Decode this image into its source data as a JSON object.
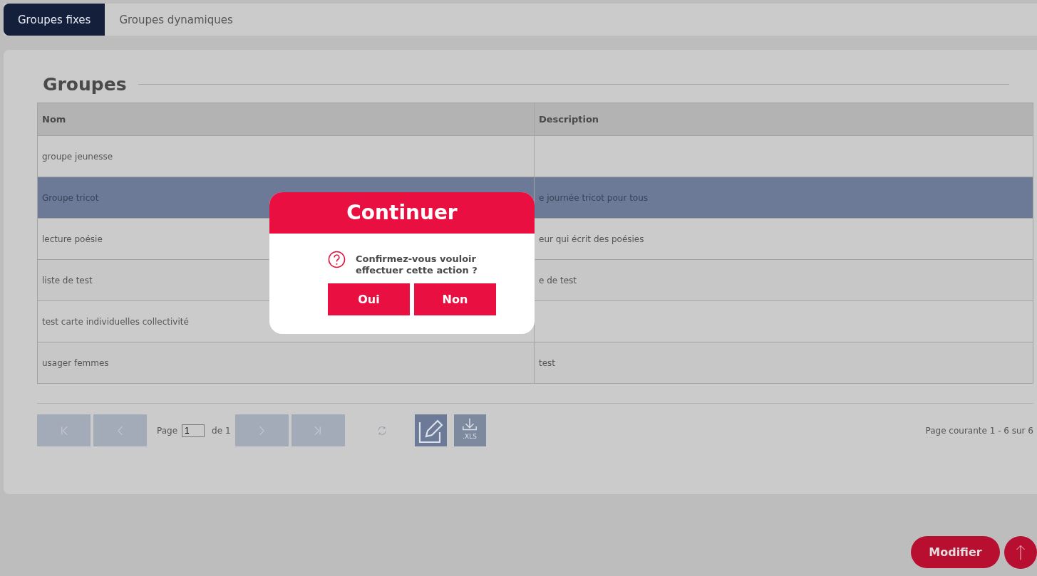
{
  "tabs": [
    {
      "label": "Groupes fixes",
      "selected": true
    },
    {
      "label": "Groupes dynamiques",
      "selected": false
    }
  ],
  "section_title": "Groupes",
  "table": {
    "columns": [
      "Nom",
      "Description"
    ],
    "rows": [
      {
        "cells": [
          "groupe jeunesse",
          ""
        ],
        "selected": false
      },
      {
        "cells": [
          "Groupe tricot",
          "e journée tricot pour tous"
        ],
        "selected": true
      },
      {
        "cells": [
          "lecture poésie",
          "eur qui écrit des poésies"
        ],
        "selected": false
      },
      {
        "cells": [
          "liste de test",
          "e de test"
        ],
        "selected": false
      },
      {
        "cells": [
          "test carte individuelles collectivité",
          ""
        ],
        "selected": false
      },
      {
        "cells": [
          "usager femmes",
          "test"
        ],
        "selected": false
      }
    ]
  },
  "pager": {
    "page_label": "Page",
    "page_value": "1",
    "of_label": "de 1",
    "summary": "Page courante 1 - 6 sur 6",
    "export_label": ".XLS"
  },
  "dialog": {
    "title": "Continuer",
    "message": "Confirmez-vous vouloir effectuer cette action ?",
    "buttons": [
      "Oui",
      "Non"
    ]
  },
  "modify_button": "Modifier"
}
